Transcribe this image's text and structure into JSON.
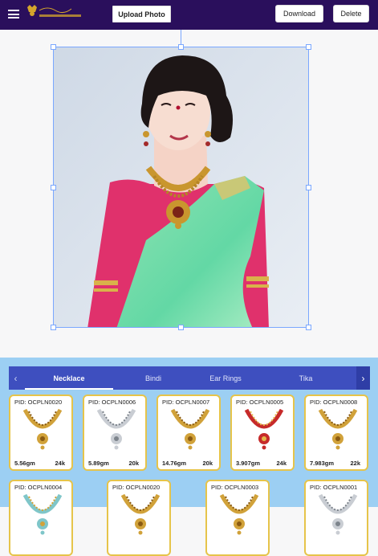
{
  "toolbar": {
    "upload_label": "Upload Photo",
    "download_label": "Download",
    "delete_label": "Delete"
  },
  "categories": {
    "tabs": [
      "Necklace",
      "Bindi",
      "Ear Rings",
      "Tika"
    ],
    "active": "Necklace"
  },
  "products": [
    {
      "pid": "PID: OCPLN0020",
      "weight": "5.56gm",
      "karat": "24k",
      "metal": "gold"
    },
    {
      "pid": "PID: OCPLN0006",
      "weight": "5.89gm",
      "karat": "20k",
      "metal": "silver"
    },
    {
      "pid": "PID: OCPLN0007",
      "weight": "14.76gm",
      "karat": "20k",
      "metal": "gold"
    },
    {
      "pid": "PID: OCPLN0005",
      "weight": "3.907gm",
      "karat": "24k",
      "metal": "ruby"
    },
    {
      "pid": "PID: OCPLN0008",
      "weight": "7.983gm",
      "karat": "22k",
      "metal": "gold"
    },
    {
      "pid": "PID: OCPLN0004",
      "weight": "",
      "karat": "",
      "metal": "teal"
    },
    {
      "pid": "PID: OCPLN0020",
      "weight": "",
      "karat": "",
      "metal": "gold"
    },
    {
      "pid": "PID: OCPLN0003",
      "weight": "",
      "karat": "",
      "metal": "gold"
    },
    {
      "pid": "PID: OCPLN0001",
      "weight": "",
      "karat": "",
      "metal": "silver"
    }
  ],
  "colors": {
    "topbar": "#2a0f5c",
    "tabbar": "#3e4fbf",
    "panel": "#9ccff3",
    "card_border": "#e6c44a"
  },
  "icons": {
    "menu": "hamburger-icon",
    "prev": "chevron-left-icon",
    "next": "chevron-right-icon"
  }
}
